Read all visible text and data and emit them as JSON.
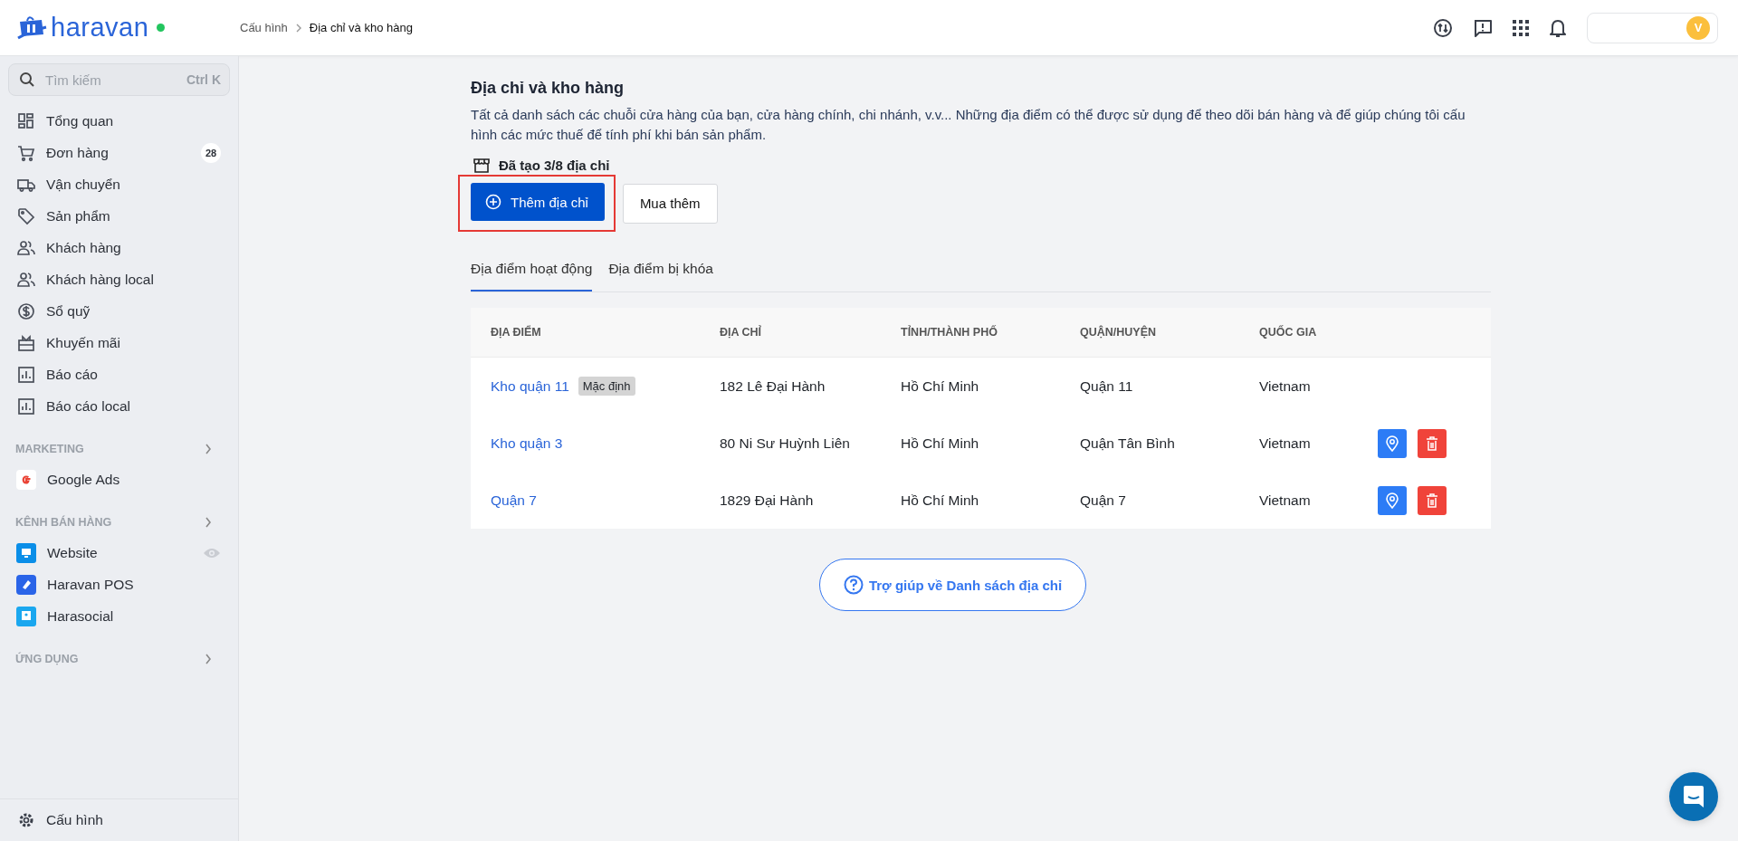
{
  "header": {
    "brand": "haravan",
    "breadcrumb": [
      "Cấu hình",
      "Địa chỉ và kho hàng"
    ],
    "avatar": "V"
  },
  "sidebar": {
    "search": {
      "placeholder": "Tìm kiếm",
      "shortcut": "Ctrl K"
    },
    "items": [
      {
        "label": "Tổng quan"
      },
      {
        "label": "Đơn hàng",
        "badge": "28"
      },
      {
        "label": "Vận chuyển"
      },
      {
        "label": "Sản phẩm"
      },
      {
        "label": "Khách hàng"
      },
      {
        "label": "Khách hàng local"
      },
      {
        "label": "Sổ quỹ"
      },
      {
        "label": "Khuyến mãi"
      },
      {
        "label": "Báo cáo"
      },
      {
        "label": "Báo cáo local"
      }
    ],
    "sections": [
      {
        "title": "MARKETING",
        "items": [
          {
            "label": "Google Ads"
          }
        ]
      },
      {
        "title": "KÊNH BÁN HÀNG",
        "items": [
          {
            "label": "Website",
            "preview": true
          },
          {
            "label": "Haravan POS",
            "preview": false
          },
          {
            "label": "Harasocial",
            "preview": false
          }
        ]
      },
      {
        "title": "ỨNG DỤNG"
      }
    ],
    "footer": "Cấu hình"
  },
  "page": {
    "title": "Địa chỉ và kho hàng",
    "description": "Tất cả danh sách các chuỗi cửa hàng của bạn, cửa hàng chính, chi nhánh, v.v... Những địa điểm có thể được sử dụng để theo dõi bán hàng và để giúp chúng tôi cấu hình các mức thuế để tính phí khi bán sản phẩm.",
    "quota": "Đã tạo 3/8 địa chỉ",
    "add_button": "Thêm địa chỉ",
    "buy_button": "Mua thêm",
    "tabs": [
      {
        "label": "Địa điểm hoạt động",
        "selected": true
      },
      {
        "label": "Địa điểm bị khóa",
        "selected": false
      }
    ],
    "table": {
      "columns": [
        "ĐỊA ĐIỂM",
        "ĐỊA CHỈ",
        "TỈNH/THÀNH PHỐ",
        "QUẬN/HUYỆN",
        "QUỐC GIA"
      ],
      "rows": [
        {
          "name": "Kho quận 11",
          "tag": "Mặc định",
          "address": "182 Lê Đại Hành",
          "province": "Hồ Chí Minh",
          "district": "Quận 11",
          "country": "Vietnam",
          "actions": false
        },
        {
          "name": "Kho quận 3",
          "address": "80 Ni Sư Huỳnh Liên",
          "province": "Hồ Chí Minh",
          "district": "Quận Tân Bình",
          "country": "Vietnam",
          "actions": true
        },
        {
          "name": "Quận 7",
          "address": "1829 Đại Hành",
          "province": "Hồ Chí Minh",
          "district": "Quận 7",
          "country": "Vietnam",
          "actions": true
        }
      ]
    },
    "help_button": "Trợ giúp về Danh sách địa chỉ"
  }
}
